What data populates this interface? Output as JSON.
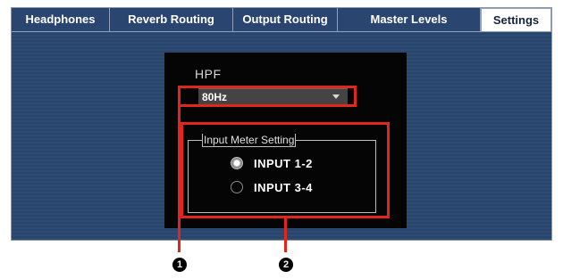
{
  "tabs": [
    {
      "label": "Headphones",
      "active": false
    },
    {
      "label": "Reverb Routing",
      "active": false
    },
    {
      "label": "Output Routing",
      "active": false
    },
    {
      "label": "Master Levels",
      "active": false
    },
    {
      "label": "Settings",
      "active": true
    }
  ],
  "settings": {
    "hpf": {
      "label": "HPF",
      "value": "80Hz"
    },
    "input_meter": {
      "title": "Input Meter Setting",
      "options": [
        {
          "label": "INPUT 1-2",
          "selected": true
        },
        {
          "label": "INPUT 3-4",
          "selected": false
        }
      ]
    }
  },
  "callouts": {
    "one": "1",
    "two": "2"
  },
  "colors": {
    "highlight": "#e1261c",
    "background": "#29456c",
    "panel": "#050505"
  }
}
